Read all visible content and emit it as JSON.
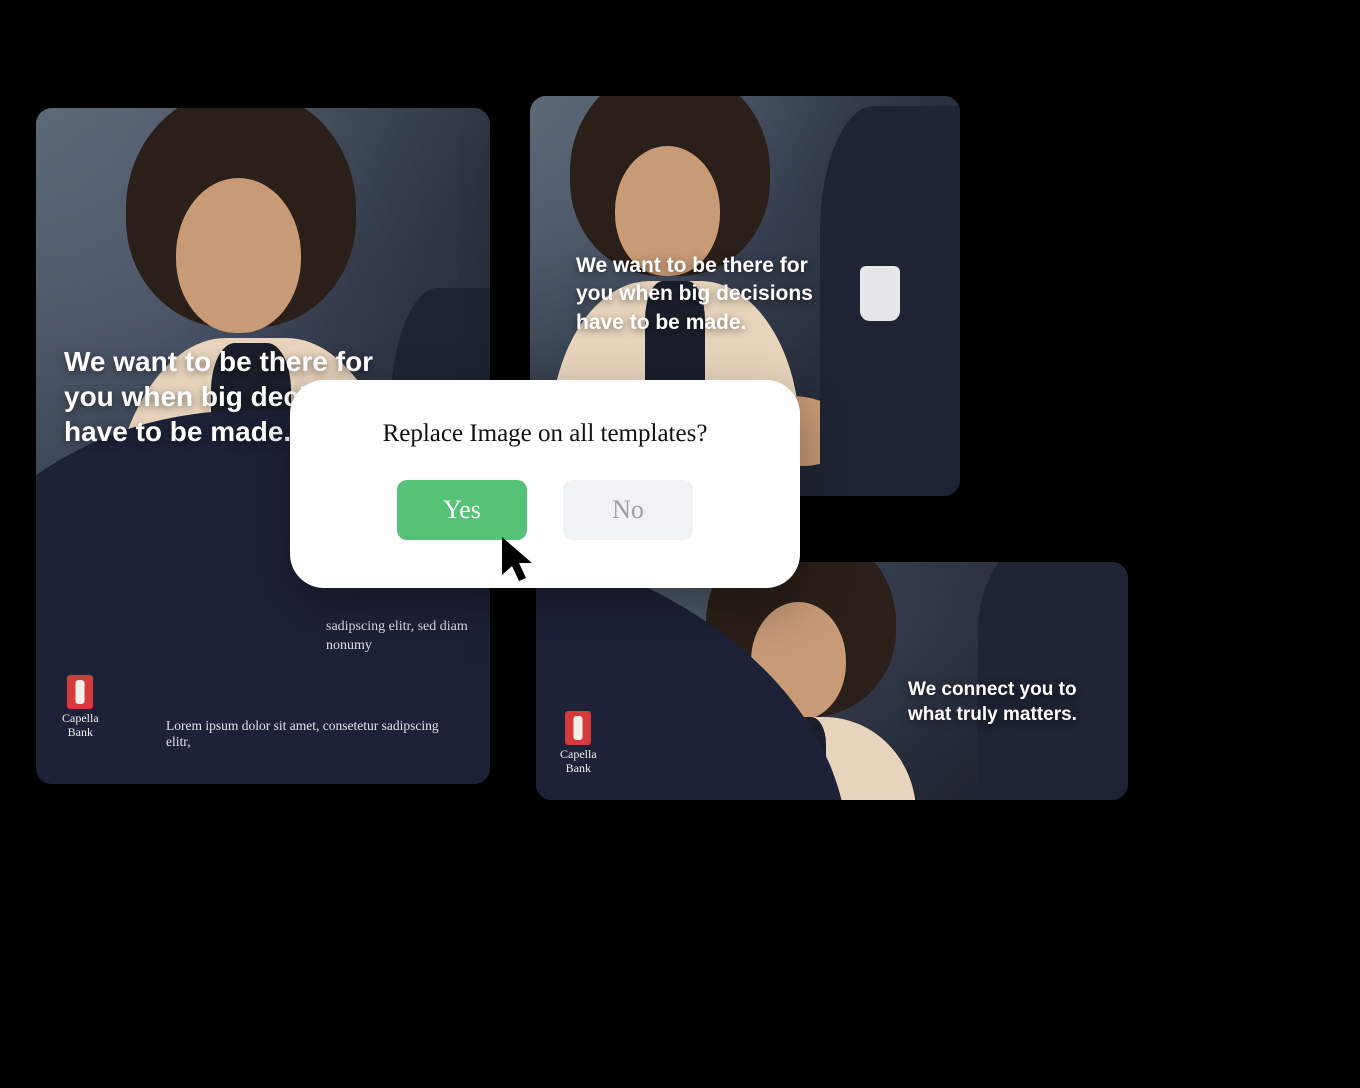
{
  "brand": {
    "name": "Capella\nBank"
  },
  "card1": {
    "headline": "We want to be there for you when big decisions have to be made.",
    "midcopy": "sadipscing elitr, sed diam nonumy",
    "footline": "Lorem ipsum dolor sit amet, consetetur sadipscing elitr,"
  },
  "card2": {
    "headline": "We want to be there for you when big decisions have to be made."
  },
  "card3": {
    "headline": "We connect you to what truly matters."
  },
  "dialog": {
    "title": "Replace Image on all templates?",
    "yes_label": "Yes",
    "no_label": "No"
  },
  "colors": {
    "accent_green": "#55c278",
    "navy": "#1e2238",
    "logo_red": "#d43c3c"
  }
}
